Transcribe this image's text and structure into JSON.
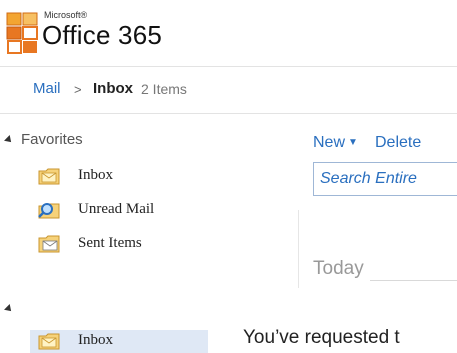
{
  "header": {
    "brand_small": "Microsoft®",
    "product_title": "Office 365",
    "logo_icon": "office-logo-icon"
  },
  "breadcrumb": {
    "root": "Mail",
    "separator": ">",
    "current": "Inbox",
    "count": "2 Items"
  },
  "sidebar": {
    "favorites_heading": "Favorites",
    "favorites": [
      {
        "label": "Inbox",
        "icon": "inbox-icon"
      },
      {
        "label": "Unread Mail",
        "icon": "search-folder-icon"
      },
      {
        "label": "Sent Items",
        "icon": "sent-items-icon"
      }
    ],
    "folders": [
      {
        "label": "Inbox",
        "icon": "inbox-icon",
        "selected": true
      }
    ]
  },
  "toolbar": {
    "new_label": "New",
    "delete_label": "Delete"
  },
  "search": {
    "placeholder": "Search Entire"
  },
  "message_list": {
    "group_label": "Today"
  },
  "message": {
    "text": "You’ve requested t"
  },
  "colors": {
    "link": "#2a6fbf",
    "selected_bg": "#dfe8f5",
    "office_orange": "#e87722"
  }
}
